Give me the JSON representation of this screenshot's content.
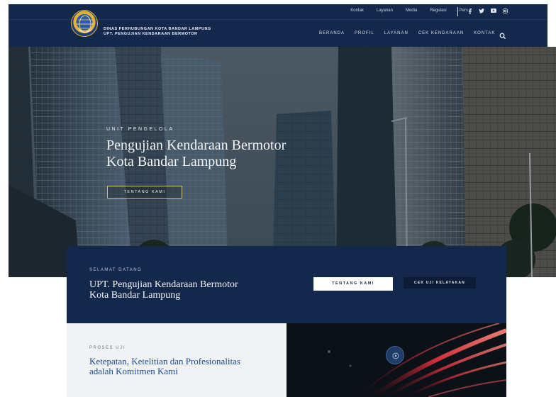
{
  "topbar": {
    "links": [
      "Kontak",
      "Layanan",
      "Media",
      "Regulasi",
      "Pers"
    ],
    "social_icons": [
      "facebook-icon",
      "twitter-icon",
      "youtube-icon",
      "instagram-icon"
    ]
  },
  "brand": {
    "line1": "DINAS PERHUBUNGAN KOTA BANDAR LAMPUNG",
    "line2": "UPT. PENGUJIAN KENDARAAN BERMOTOR"
  },
  "nav": {
    "items": [
      "BERANDA",
      "PROFIL",
      "LAYANAN",
      "CEK KENDARAAN",
      "KONTAK"
    ]
  },
  "hero": {
    "eyebrow": "UNIT PENGELOLA",
    "title_line1": "Pengujian Kendaraan Bermotor",
    "title_line2": "Kota Bandar Lampung",
    "button": "TENTANG KAMI"
  },
  "welcome": {
    "eyebrow": "SELAMAT DATANG",
    "title_line1": "UPT. Pengujian Kendaraan Bermotor",
    "title_line2": "Kota Bandar Lampung",
    "button_primary": "TENTANG KAMI",
    "button_secondary": "CEK UJI KELAYAKAN"
  },
  "process": {
    "eyebrow": "PROSES UJI",
    "title_line1": "Ketepatan, Ketelitian dan Profesionalitas",
    "title_line2": "adalah Komitmen Kami"
  },
  "colors": {
    "navy": "#13284a",
    "gold": "#d8c27a",
    "link_blue": "#1c4c8a"
  }
}
